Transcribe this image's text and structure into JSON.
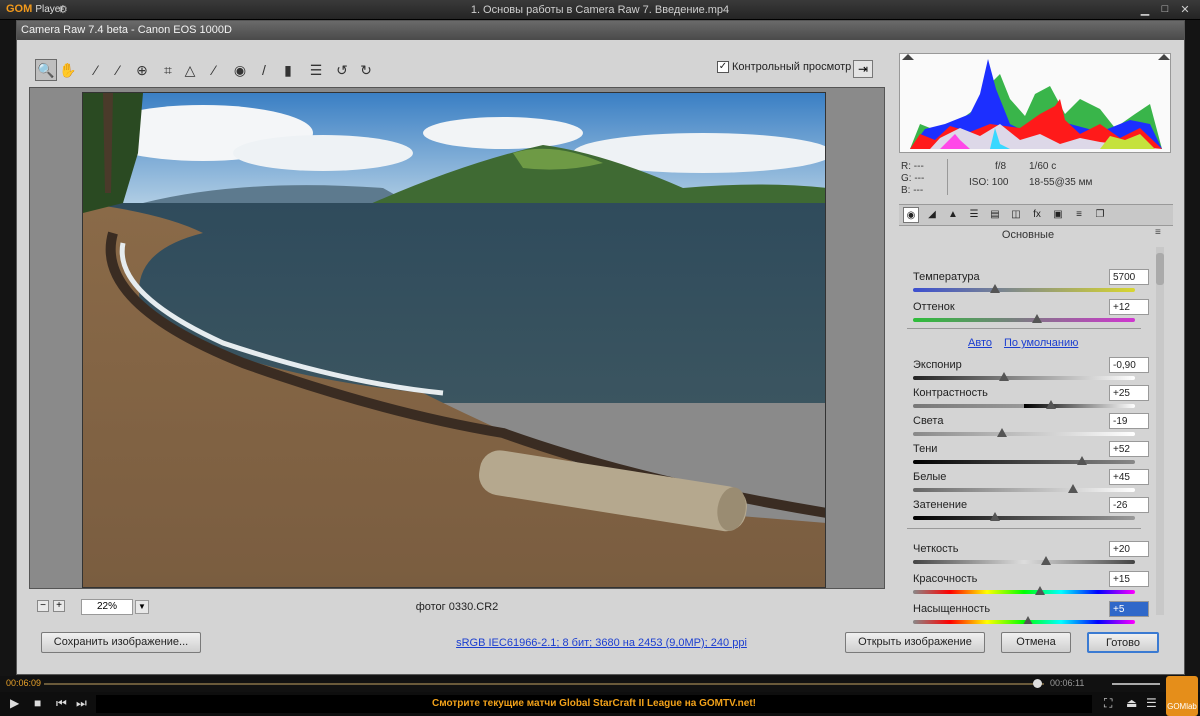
{
  "player": {
    "logo": "GOM",
    "logo_sub": "Player",
    "file_title": "1. Основы работы в Camera Raw 7. Введение.mp4",
    "current_time": "00:06:09",
    "total_time": "00:06:11",
    "ticker": "Смотрите текущие матчи Global StarCraft II League на GOMTV.net!",
    "gomlab_label": "GOMlab",
    "progress": 0.993
  },
  "dialog": {
    "title": "Camera Raw 7.4 beta  -  Canon EOS 1000D",
    "preview_label": "Контрольный просмотр",
    "zoom": "22%",
    "filename": "фотог 0330.CR2"
  },
  "info": {
    "r": "R:  ---",
    "g": "G:  ---",
    "b": "B:  ---",
    "aperture": "f/8",
    "shutter": "1/60 с",
    "iso": "ISO: 100",
    "lens": "18-55@35 мм"
  },
  "panel": {
    "title": "Основные",
    "auto": "Авто",
    "default": "По умолчанию"
  },
  "sliders": [
    {
      "label": "Температура",
      "value": "5700",
      "pos": 0.37
    },
    {
      "label": "Оттенок",
      "value": "+12",
      "pos": 0.56
    },
    {
      "label": "Экспонир",
      "value": "-0,90",
      "pos": 0.41
    },
    {
      "label": "Контрастность",
      "value": "+25",
      "pos": 0.62
    },
    {
      "label": "Света",
      "value": "-19",
      "pos": 0.4
    },
    {
      "label": "Тени",
      "value": "+52",
      "pos": 0.76
    },
    {
      "label": "Белые",
      "value": "+45",
      "pos": 0.72
    },
    {
      "label": "Затенение",
      "value": "-26",
      "pos": 0.37
    },
    {
      "label": "Четкость",
      "value": "+20",
      "pos": 0.6
    },
    {
      "label": "Красочность",
      "value": "+15",
      "pos": 0.57
    },
    {
      "label": "Насыщенность",
      "value": "+5",
      "pos": 0.52
    }
  ],
  "footer": {
    "save": "Сохранить изображение...",
    "workflow": "sRGB IEC61966-2.1; 8 бит; 3680 на 2453 (9,0МР); 240 ppi",
    "open": "Открыть изображение",
    "cancel": "Отмена",
    "done": "Готово"
  },
  "colors": {
    "accent_orange": "#f2a21a",
    "link_blue": "#1b3ed0"
  }
}
